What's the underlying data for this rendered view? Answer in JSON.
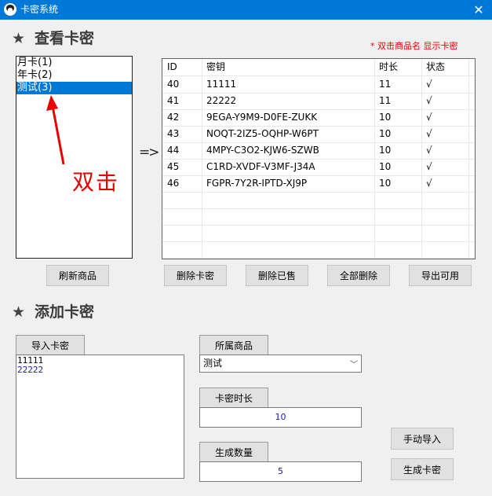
{
  "window": {
    "title": "卡密系统",
    "close_glyph": "✕"
  },
  "view_section": {
    "star": "★",
    "title": "查看卡密",
    "hint": "* 双击商品名 显示卡密"
  },
  "products": {
    "items": [
      {
        "label": "月卡(1)",
        "selected": false
      },
      {
        "label": "年卡(2)",
        "selected": false
      },
      {
        "label": "测试(3)",
        "selected": true
      }
    ],
    "annotation": "双击",
    "goto_glyph": "=>"
  },
  "table": {
    "headers": [
      "ID",
      "密钥",
      "时长",
      "状态"
    ],
    "rows": [
      [
        "40",
        "11111",
        "11",
        "√"
      ],
      [
        "41",
        "22222",
        "11",
        "√"
      ],
      [
        "42",
        "9EGA-Y9M9-D0FE-ZUKK",
        "10",
        "√"
      ],
      [
        "43",
        "NOQT-2IZ5-OQHP-W6PT",
        "10",
        "√"
      ],
      [
        "44",
        "4MPY-C3O2-KJW6-SZWB",
        "10",
        "√"
      ],
      [
        "45",
        "C1RD-XVDF-V3MF-J34A",
        "10",
        "√"
      ],
      [
        "46",
        "FGPR-7Y2R-IPTD-XJ9P",
        "10",
        "√"
      ]
    ]
  },
  "buttons": {
    "refresh": "刷新商品",
    "delete_key": "删除卡密",
    "delete_sold": "删除已售",
    "delete_all": "全部删除",
    "export_available": "导出可用",
    "manual_import": "手动导入",
    "generate": "生成卡密"
  },
  "add_section": {
    "star": "★",
    "title": "添加卡密",
    "import_label": "导入卡密",
    "import_lines": [
      "11111",
      "22222"
    ],
    "product_label": "所属商品",
    "product_value": "测试",
    "duration_label": "卡密时长",
    "duration_value": "10",
    "quantity_label": "生成数量",
    "quantity_value": "5"
  },
  "colors": {
    "titlebar": "#0078d7",
    "selection": "#0078d7",
    "hint": "#e60000"
  }
}
